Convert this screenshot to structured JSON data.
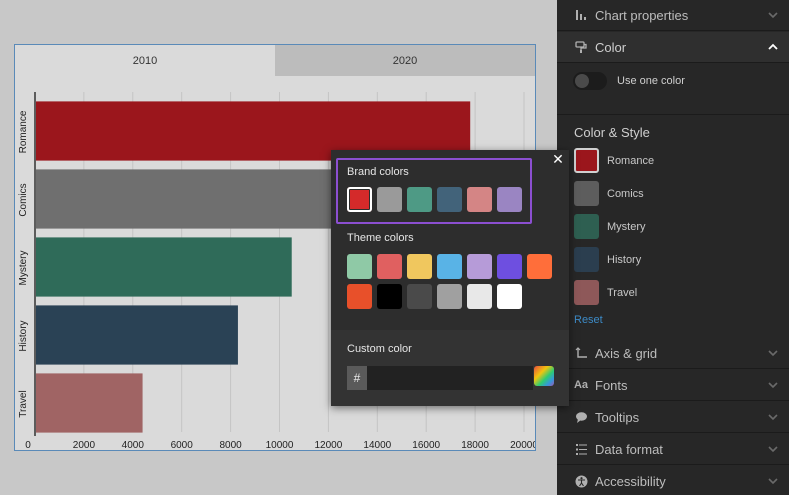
{
  "chart": {
    "tabs": [
      {
        "label": "2010",
        "active": true
      },
      {
        "label": "2020",
        "active": false
      }
    ]
  },
  "chart_data": {
    "type": "bar",
    "orientation": "horizontal",
    "categories": [
      "Romance",
      "Comics",
      "Mystery",
      "History",
      "Travel"
    ],
    "values": [
      17800,
      13000,
      10500,
      8300,
      4400
    ],
    "colors": [
      "#9b161c",
      "#6f6f6f",
      "#2f6b59",
      "#2a4255",
      "#a06464"
    ],
    "x_ticks": [
      0,
      2000,
      4000,
      6000,
      8000,
      10000,
      12000,
      14000,
      16000,
      18000,
      20000
    ],
    "xlim": [
      0,
      20000
    ],
    "grid": true
  },
  "sidebar": {
    "chart_properties": "Chart properties",
    "color": "Color",
    "use_one_color": "Use one color",
    "color_style": "Color & Style",
    "legend_items": [
      {
        "label": "Romance",
        "color": "#9b161c"
      },
      {
        "label": "Comics",
        "color": "#5d5d5d"
      },
      {
        "label": "Mystery",
        "color": "#2e5f51"
      },
      {
        "label": "History",
        "color": "#2b3e4f"
      },
      {
        "label": "Travel",
        "color": "#8e5859"
      }
    ],
    "reset": "Reset",
    "axis_grid": "Axis & grid",
    "fonts": "Fonts",
    "tooltips": "Tooltips",
    "data_format": "Data format",
    "accessibility": "Accessibility"
  },
  "popover": {
    "brand_title": "Brand colors",
    "brand_colors": [
      "#d42a2a",
      "#9a9a9a",
      "#4e9a85",
      "#42637a",
      "#d48585",
      "#9a85c2"
    ],
    "theme_title": "Theme colors",
    "theme_colors_row1": [
      "#8fc9a6",
      "#e06060",
      "#f0c75e",
      "#59b3e6",
      "#b69bd8",
      "#6e4fe0",
      "#ff6e3a"
    ],
    "theme_colors_row2": [
      "#e8502a",
      "#000000",
      "#4a4a4a",
      "#a0a0a0",
      "#e8e8e8",
      "#ffffff"
    ],
    "custom_title": "Custom color",
    "hash": "#",
    "hex_value": ""
  }
}
